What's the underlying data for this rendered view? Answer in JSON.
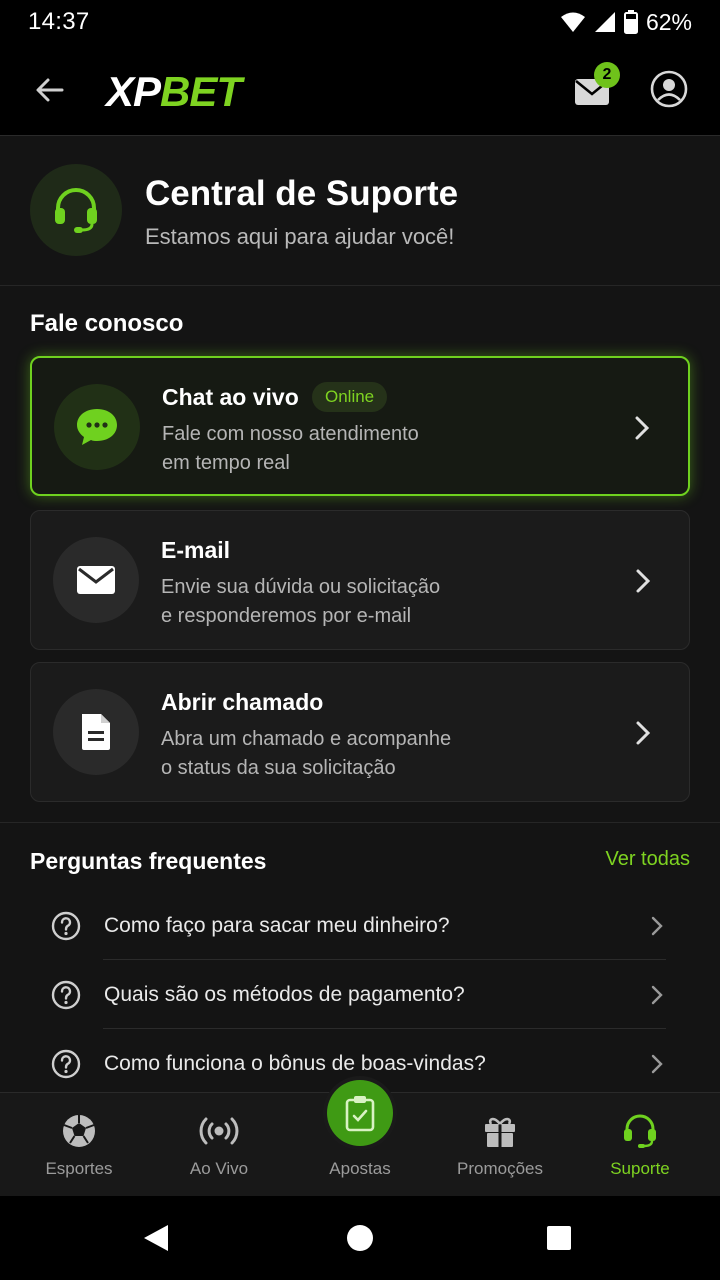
{
  "status_bar": {
    "time": "14:37",
    "battery": "62%"
  },
  "header": {
    "logo_xp": "XP",
    "logo_bet": "BET",
    "mail_badge": "2"
  },
  "hero": {
    "title": "Central de Suporte",
    "subtitle": "Estamos aqui para ajudar você!"
  },
  "contact": {
    "section_title": "Fale conosco",
    "cards": [
      {
        "title": "Chat ao vivo",
        "badge": "Online",
        "line1": "Fale com nosso atendimento",
        "line2": "em tempo real",
        "icon": "chat-bubble-icon"
      },
      {
        "title": "E-mail",
        "line1": "Envie sua dúvida ou solicitação",
        "line2": "e responderemos por e-mail",
        "icon": "envelope-icon"
      },
      {
        "title": "Abrir chamado",
        "line1": "Abra um chamado e acompanhe",
        "line2": "o status da sua solicitação",
        "icon": "document-icon"
      }
    ]
  },
  "faq": {
    "title": "Perguntas frequentes",
    "see_all": "Ver todas",
    "items": [
      {
        "question": "Como faço para sacar meu dinheiro?"
      },
      {
        "question": "Quais são os métodos de pagamento?"
      },
      {
        "question": "Como funciona o bônus de boas-vindas?"
      }
    ]
  },
  "bottom_nav": {
    "items": [
      {
        "label": "Esportes",
        "icon": "soccer-ball-icon"
      },
      {
        "label": "Ao Vivo",
        "icon": "live-broadcast-icon"
      },
      {
        "label": "Apostas",
        "icon": "bet-slip-icon"
      },
      {
        "label": "Promoções",
        "icon": "gift-icon"
      },
      {
        "label": "Suporte",
        "icon": "headset-icon"
      }
    ],
    "active": "Suporte"
  },
  "colors": {
    "accent": "#7ed321",
    "background": "#141414",
    "card": "#1b1b1b"
  }
}
